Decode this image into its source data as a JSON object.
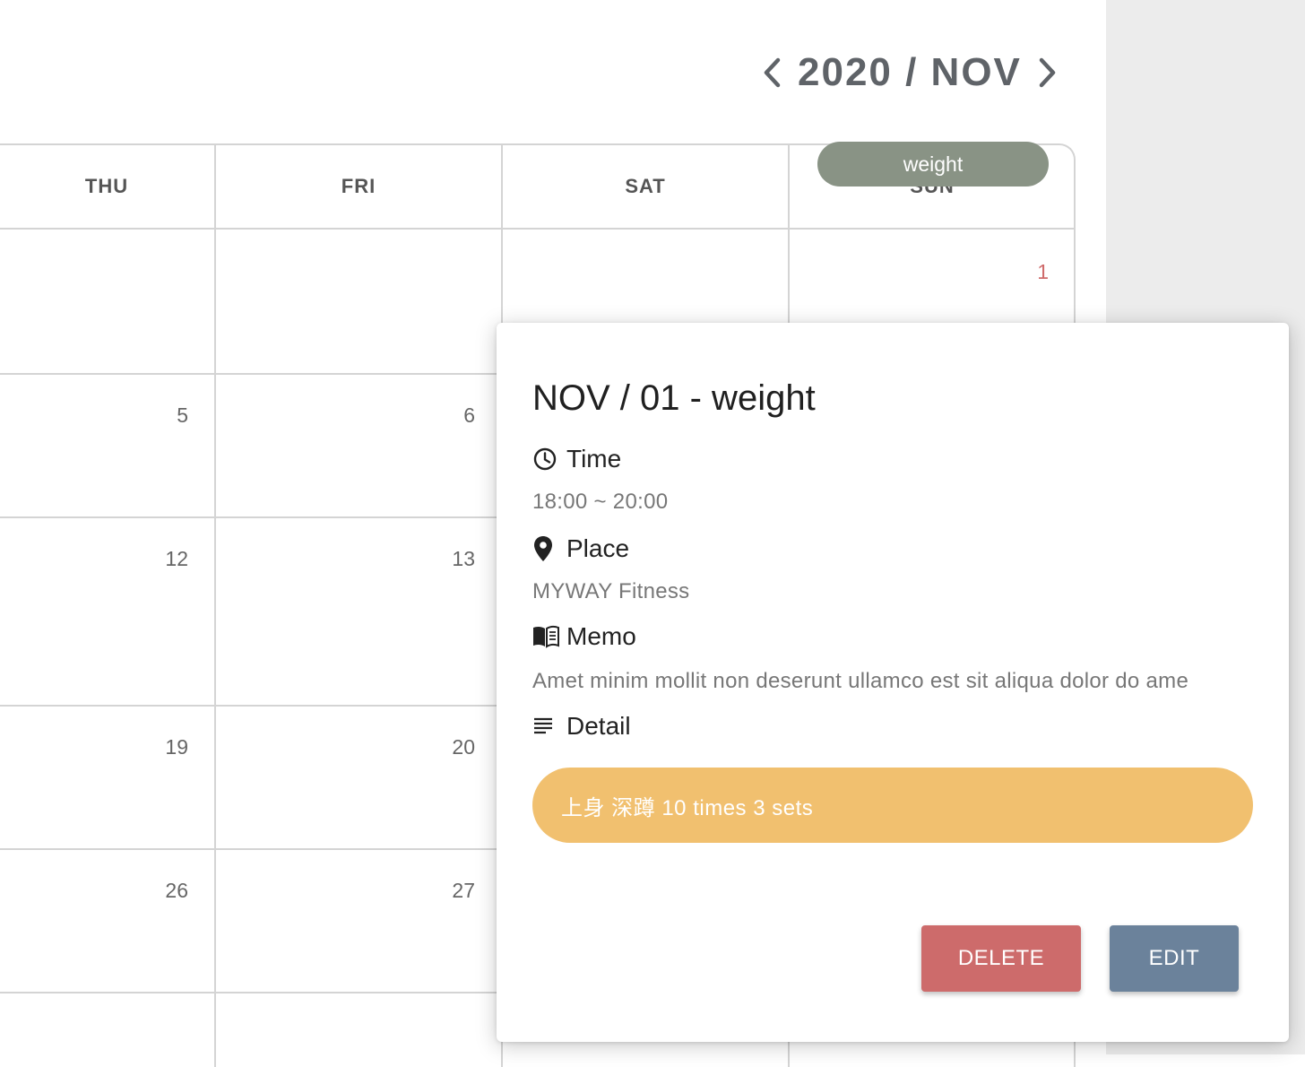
{
  "header": {
    "month_title": "2020 / NOV",
    "prev_icon": "chevron-left-icon",
    "next_icon": "chevron-right-icon"
  },
  "calendar": {
    "weekdays": [
      "THU",
      "FRI",
      "SAT",
      "SUN"
    ],
    "days": [
      {
        "num": "1",
        "highlight": true
      },
      {
        "num": "5"
      },
      {
        "num": "6"
      },
      {
        "num": "12"
      },
      {
        "num": "13"
      },
      {
        "num": "19"
      },
      {
        "num": "20"
      },
      {
        "num": "26"
      },
      {
        "num": "27"
      }
    ],
    "event_label": "weight",
    "event_color": "#899385",
    "highlight_color": "#cf6b6b"
  },
  "popup": {
    "title": "NOV / 01 - weight",
    "time_label": "Time",
    "time_value": "18:00 ~ 20:00",
    "place_label": "Place",
    "place_value": "MYWAY Fitness",
    "memo_label": "Memo",
    "memo_value": "Amet minim mollit non deserunt ullamco est sit aliqua dolor do ame",
    "detail_label": "Detail",
    "detail_items": [
      "上身 深蹲 10 times 3 sets"
    ],
    "detail_color": "#f1c06f",
    "delete_label": "DELETE",
    "edit_label": "EDIT",
    "delete_color": "#cd6b6b",
    "edit_color": "#6b829b"
  }
}
